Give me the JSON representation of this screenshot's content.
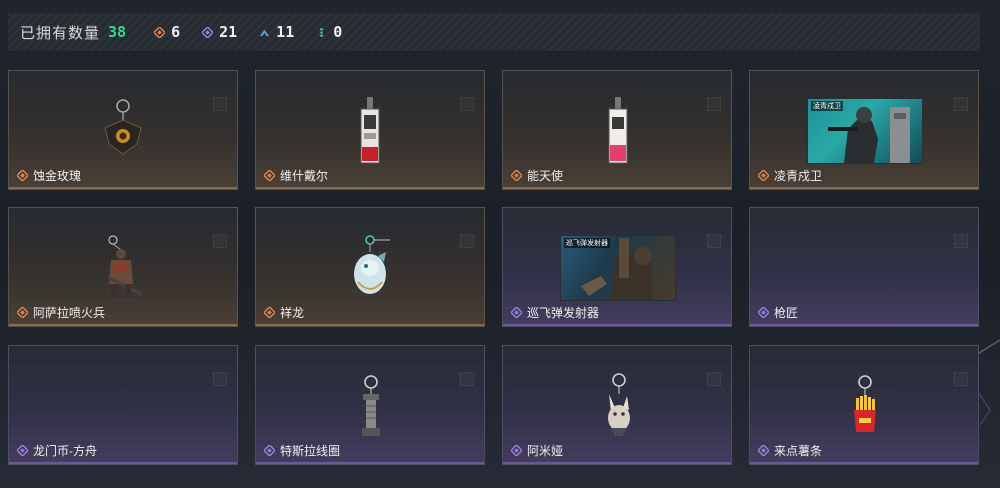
{
  "header": {
    "owned_label": "已拥有数量",
    "owned_total": "38",
    "counts": [
      {
        "icon": "orange-diamond-icon",
        "color": "#e0854a",
        "value": "6"
      },
      {
        "icon": "purple-diamond-icon",
        "color": "#9a7fe0",
        "value": "21"
      },
      {
        "icon": "blue-chevron-icon",
        "color": "#5aa3e0",
        "value": "11"
      },
      {
        "icon": "teal-dots-icon",
        "color": "#3fc7a8",
        "value": "0"
      }
    ]
  },
  "rarity_colors": {
    "orange": "#e0854a",
    "purple": "#9a7fe0"
  },
  "items": [
    {
      "name": "蚀金玫瑰",
      "rarity": "orange",
      "image": "rose-keychain"
    },
    {
      "name": "维什戴尔",
      "rarity": "orange",
      "image": "tag-keychain"
    },
    {
      "name": "能天使",
      "rarity": "orange",
      "image": "tag-keychain-pink"
    },
    {
      "name": "凌青戍卫",
      "rarity": "orange",
      "image": "photo-soldier",
      "photo_tag": "凌青戍卫"
    },
    {
      "name": "阿萨拉喷火兵",
      "rarity": "orange",
      "image": "soldier-keychain"
    },
    {
      "name": "祥龙",
      "rarity": "orange",
      "image": "dragon-keychain"
    },
    {
      "name": "巡飞弹发射器",
      "rarity": "purple",
      "image": "photo-launcher",
      "photo_tag": "巡飞弹发射器"
    },
    {
      "name": "枪匠",
      "rarity": "purple",
      "image": "empty"
    },
    {
      "name": "龙门币-方舟",
      "rarity": "purple",
      "image": "empty"
    },
    {
      "name": "特斯拉线圈",
      "rarity": "purple",
      "image": "coil-keychain"
    },
    {
      "name": "阿米娅",
      "rarity": "purple",
      "image": "bunny-keychain"
    },
    {
      "name": "来点薯条",
      "rarity": "purple",
      "image": "fries-keychain"
    }
  ]
}
